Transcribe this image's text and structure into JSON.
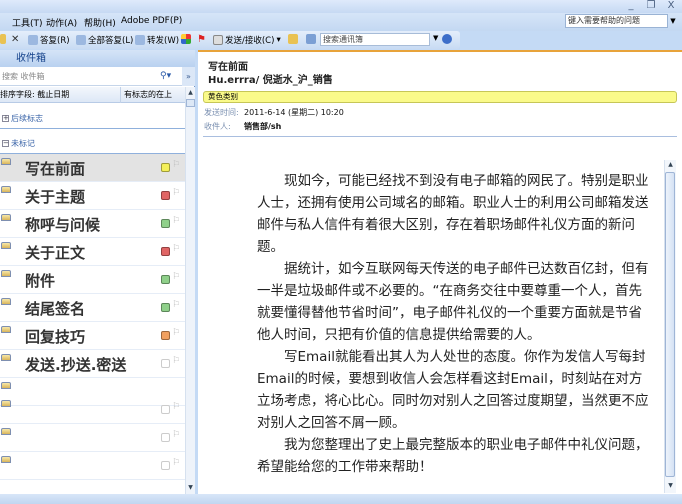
{
  "window": {
    "minimize": "_",
    "restore": "❐",
    "close": "X"
  },
  "menu": [
    "工具(T)",
    "动作(A)",
    "帮助(H)",
    "Adobe PDF(P)"
  ],
  "help_box": {
    "placeholder": "键入需要帮助的问题"
  },
  "toolbar": {
    "reply": "答复(R)",
    "reply_all": "全部答复(L)",
    "forward": "转发(W)",
    "send_receive": "发送/接收(C)",
    "address_search": "搜索通讯簿"
  },
  "left_pane": {
    "title": "收件箱",
    "search_placeholder": "搜索 收件箱",
    "sort_by": "排序字段: 截止日期",
    "sort_order": "有标志的在上",
    "groups": [
      "后续标志",
      "未标记"
    ],
    "items": [
      {
        "subject": "写在前面",
        "category_color": "#f4f05a"
      },
      {
        "subject": "关于主题",
        "category_color": "#e06565"
      },
      {
        "subject": "称呼与问候",
        "category_color": "#8fd08a"
      },
      {
        "subject": "关于正文",
        "category_color": "#e06565"
      },
      {
        "subject": "附件",
        "category_color": "#8fd08a"
      },
      {
        "subject": "结尾签名",
        "category_color": "#8fd08a"
      },
      {
        "subject": "回复技巧",
        "category_color": "#f0a060"
      },
      {
        "subject": "发送.抄送.密送",
        "category_color": "#ffffff"
      },
      {
        "subject": "",
        "category_color": ""
      },
      {
        "subject": "",
        "category_color": "#ffffff"
      },
      {
        "subject": "",
        "category_color": "#ffffff"
      },
      {
        "subject": "",
        "category_color": "#ffffff"
      }
    ]
  },
  "reading": {
    "subject": "写在前面",
    "from": "Hu.errra/ 倪逝水_沪_销售",
    "category": "黄色类别",
    "sent_label": "发送时间:",
    "sent_value": "2011-6-14 (星期二) 10:20",
    "to_label": "收件人:",
    "to_value": "销售部/sh",
    "body": [
      "现如今，可能已经找不到没有电子邮箱的网民了。特别是职业人士，还拥有使用公司域名的邮箱。职业人士的利用公司邮箱发送邮件与私人信件有着很大区别，存在着职场邮件礼仪方面的新问题。",
      "据统计，如今互联网每天传送的电子邮件已达数百亿封，但有一半是垃圾邮件或不必要的。“在商务交往中要尊重一个人，首先就要懂得替他节省时间”，电子邮件礼仪的一个重要方面就是节省他人时间，只把有价值的信息提供给需要的人。",
      "写Email就能看出其人为人处世的态度。你作为发信人写每封Email的时候，要想到收信人会怎样看这封Email，时刻站在对方立场考虑，将心比心。同时勿对别人之回答过度期望，当然更不应对别人之回答不屑一顾。",
      "我为您整理出了史上最完整版本的职业电子邮件中礼仪问题，希望能给您的工作带来帮助！"
    ]
  }
}
